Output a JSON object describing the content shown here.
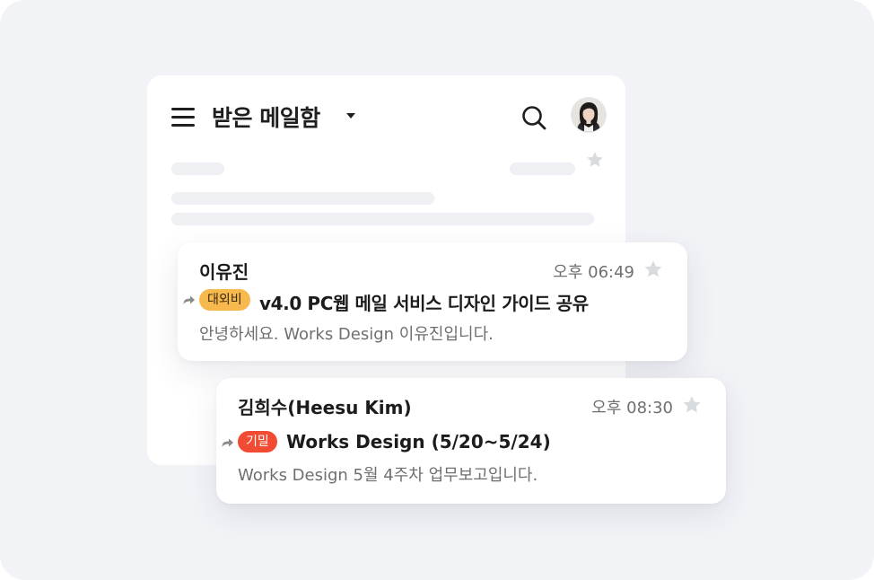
{
  "header": {
    "folder_title": "받은 메일함"
  },
  "colors": {
    "background": "#f2f3f7",
    "card": "#ffffff",
    "tag_external": "#f7b84e",
    "tag_confidential": "#f24b33",
    "star_inactive": "#d9dcdf"
  },
  "icons": {
    "menu": "hamburger-menu-icon",
    "caret": "caret-down-icon",
    "search": "search-icon",
    "star": "star-icon",
    "forward": "forward-arrow-icon"
  },
  "mails": [
    {
      "sender": "이유진",
      "time": "오후 06:49",
      "tag": "대외비",
      "subject": "v4.0 PC웹 메일 서비스 디자인 가이드 공유",
      "preview": "안녕하세요. Works Design 이유진입니다."
    },
    {
      "sender": "김희수(Heesu Kim)",
      "time": "오후 08:30",
      "tag": "기밀",
      "subject": "Works Design (5/20~5/24)",
      "preview": "Works Design 5월 4주차 업무보고입니다."
    }
  ]
}
